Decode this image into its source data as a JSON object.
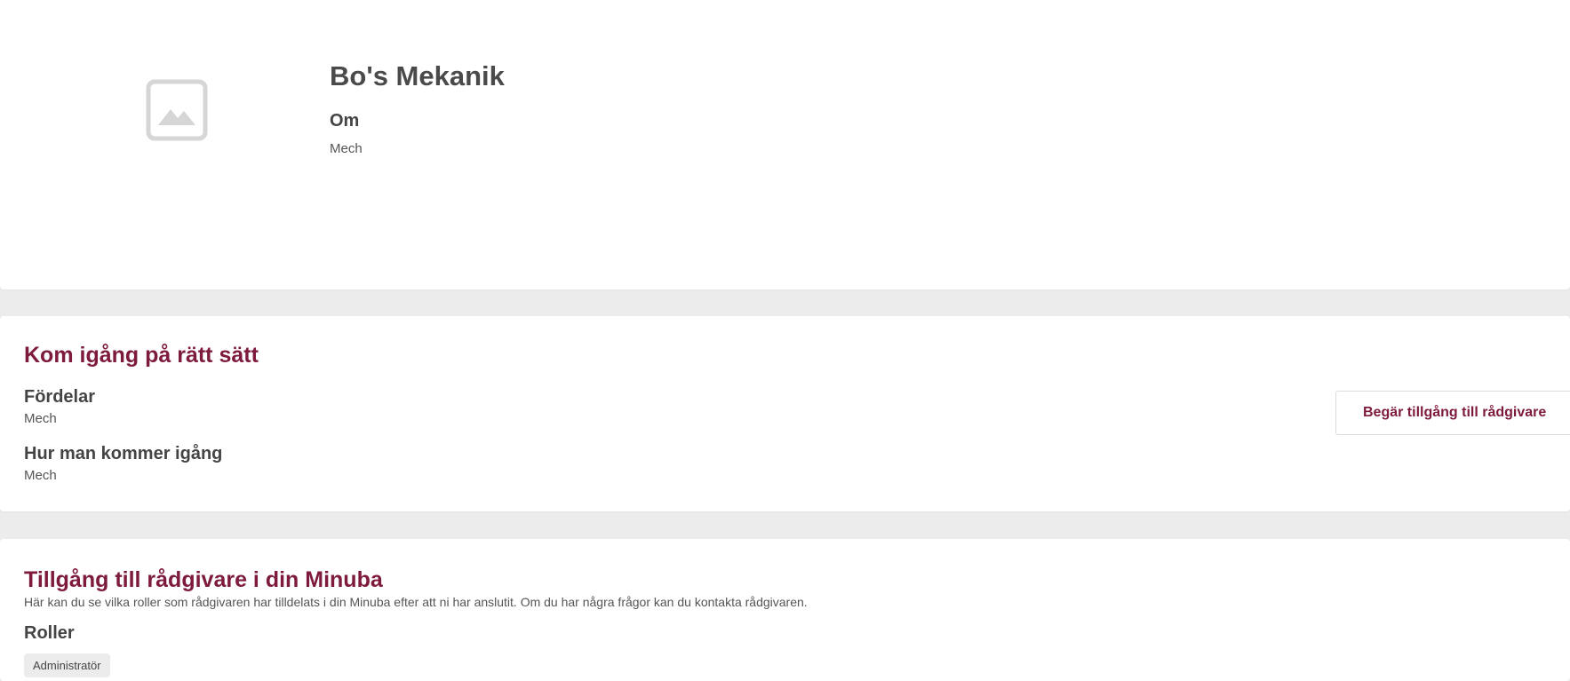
{
  "profile": {
    "company_name": "Bo's Mekanik",
    "about_heading": "Om",
    "about_text": "Mech",
    "logo_icon": "image-placeholder-icon"
  },
  "getting_started": {
    "title": "Kom igång på rätt sätt",
    "benefits_heading": "Fördelar",
    "benefits_text": "Mech",
    "how_to_heading": "Hur man kommer igång",
    "how_to_text": "Mech",
    "request_button_label": "Begär tillgång till rådgivare"
  },
  "advisor_access": {
    "title": "Tillgång till rådgivare i din Minuba",
    "description": "Här kan du se vilka roller som rådgivaren har tilldelats i din Minuba efter att ni har anslutit. Om du har några frågor kan du kontakta rådgivaren.",
    "roles_heading": "Roller",
    "role_chip": "Administratör"
  },
  "colors": {
    "accent": "#7d1a3d",
    "page_background": "#ececec",
    "card_background": "#ffffff",
    "text": "#4a4a4a"
  }
}
